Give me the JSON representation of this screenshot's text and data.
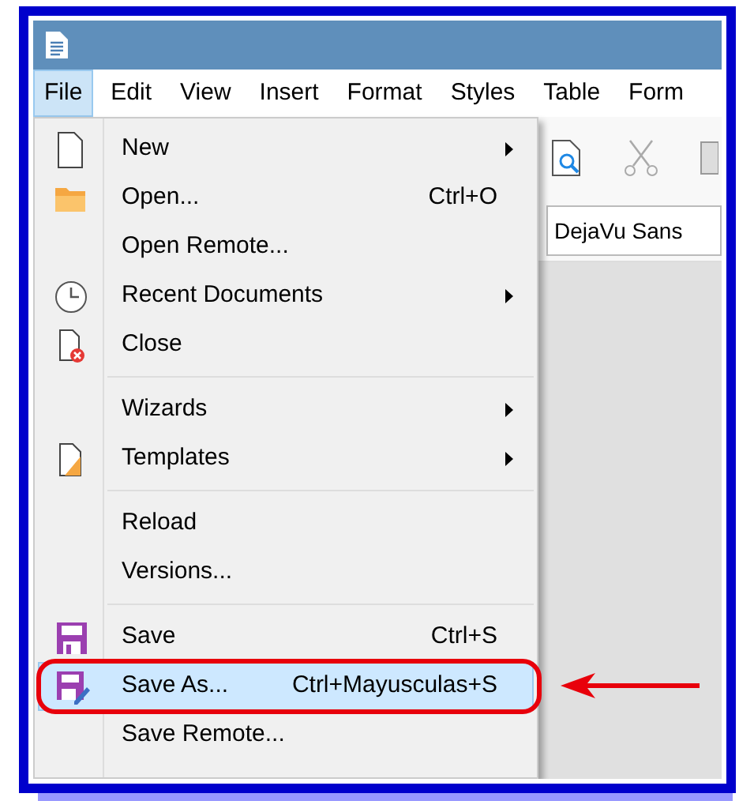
{
  "menubar": [
    {
      "label": "File",
      "selected": true
    },
    {
      "label": "Edit",
      "selected": false
    },
    {
      "label": "View",
      "selected": false
    },
    {
      "label": "Insert",
      "selected": false
    },
    {
      "label": "Format",
      "selected": false
    },
    {
      "label": "Styles",
      "selected": false
    },
    {
      "label": "Table",
      "selected": false
    },
    {
      "label": "Form",
      "selected": false
    }
  ],
  "file_menu": [
    {
      "kind": "item",
      "label": "New",
      "submenu": true,
      "selected": false,
      "annotated": false
    },
    {
      "kind": "item",
      "label": "Open...",
      "shortcut": "Ctrl+O",
      "submenu": false,
      "selected": false,
      "annotated": false
    },
    {
      "kind": "item",
      "label": "Open Remote...",
      "submenu": false,
      "selected": false,
      "annotated": false
    },
    {
      "kind": "item",
      "label": "Recent Documents",
      "submenu": true,
      "selected": false,
      "annotated": false
    },
    {
      "kind": "item",
      "label": "Close",
      "submenu": false,
      "selected": false,
      "annotated": false
    },
    {
      "kind": "separator"
    },
    {
      "kind": "item",
      "label": "Wizards",
      "submenu": true,
      "selected": false,
      "annotated": false
    },
    {
      "kind": "item",
      "label": "Templates",
      "submenu": true,
      "selected": false,
      "annotated": false
    },
    {
      "kind": "separator"
    },
    {
      "kind": "item",
      "label": "Reload",
      "submenu": false,
      "selected": false,
      "annotated": false
    },
    {
      "kind": "item",
      "label": "Versions...",
      "submenu": false,
      "selected": false,
      "annotated": false
    },
    {
      "kind": "separator"
    },
    {
      "kind": "item",
      "label": "Save",
      "shortcut": "Ctrl+S",
      "submenu": false,
      "selected": false,
      "annotated": false
    },
    {
      "kind": "item",
      "label": "Save As...",
      "shortcut": "Ctrl+Mayusculas+S",
      "submenu": false,
      "selected": true,
      "annotated": true
    },
    {
      "kind": "item",
      "label": "Save Remote...",
      "submenu": false,
      "selected": false,
      "annotated": false
    }
  ],
  "font_name_field": {
    "value": "DejaVu Sans"
  }
}
